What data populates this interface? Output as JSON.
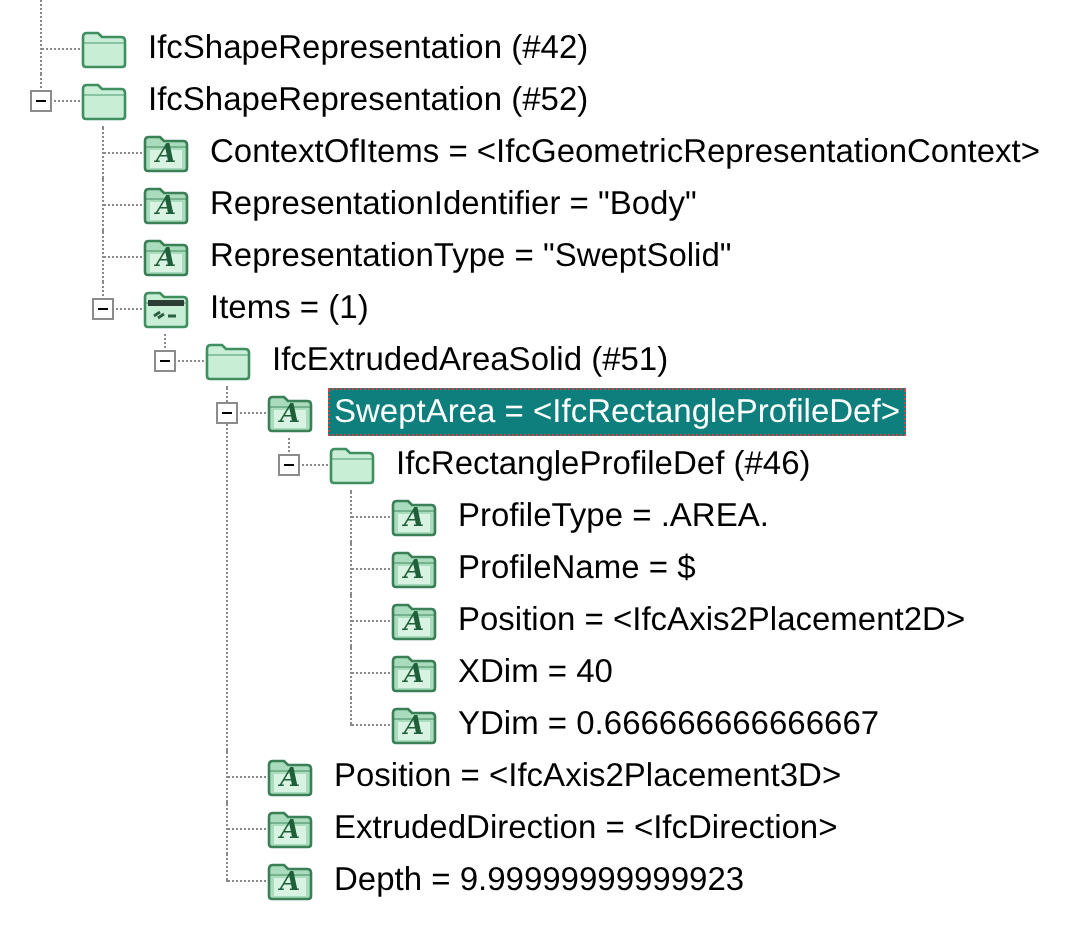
{
  "tree": {
    "nodes": [
      {
        "kind": "entity",
        "label": "IfcShapeRepresentation (#42)",
        "selected": false
      },
      {
        "kind": "entity",
        "label": "IfcShapeRepresentation (#52)",
        "selected": false,
        "expanded": true,
        "children": [
          {
            "kind": "attribute",
            "icon": "A",
            "label": "ContextOfItems = <IfcGeometricRepresentationContext>",
            "selected": false
          },
          {
            "kind": "attribute",
            "icon": "A",
            "label": "RepresentationIdentifier = \"Body\"",
            "selected": false
          },
          {
            "kind": "attribute",
            "icon": "A",
            "label": "RepresentationType = \"SweptSolid\"",
            "selected": false
          },
          {
            "kind": "list",
            "label": "Items = (1)",
            "selected": false,
            "expanded": true,
            "children": [
              {
                "kind": "entity",
                "label": "IfcExtrudedAreaSolid (#51)",
                "selected": false,
                "expanded": true,
                "children": [
                  {
                    "kind": "attribute",
                    "icon": "A",
                    "label": "SweptArea = <IfcRectangleProfileDef>",
                    "selected": true,
                    "expanded": true,
                    "children": [
                      {
                        "kind": "entity",
                        "label": "IfcRectangleProfileDef (#46)",
                        "selected": false,
                        "expanded": true,
                        "children": [
                          {
                            "kind": "attribute",
                            "icon": "A",
                            "label": "ProfileType = .AREA.",
                            "selected": false
                          },
                          {
                            "kind": "attribute",
                            "icon": "A",
                            "label": "ProfileName = $",
                            "selected": false
                          },
                          {
                            "kind": "attribute",
                            "icon": "A",
                            "label": "Position = <IfcAxis2Placement2D>",
                            "selected": false
                          },
                          {
                            "kind": "attribute",
                            "icon": "A",
                            "label": "XDim = 40",
                            "selected": false
                          },
                          {
                            "kind": "attribute",
                            "icon": "A",
                            "label": "YDim = 0.666666666666667",
                            "selected": false
                          }
                        ]
                      }
                    ]
                  },
                  {
                    "kind": "attribute",
                    "icon": "A",
                    "label": "Position = <IfcAxis2Placement3D>",
                    "selected": false
                  },
                  {
                    "kind": "attribute",
                    "icon": "A",
                    "label": "ExtrudedDirection = <IfcDirection>",
                    "selected": false
                  },
                  {
                    "kind": "attribute",
                    "icon": "A",
                    "label": "Depth = 9.99999999999923",
                    "selected": false
                  }
                ]
              }
            ]
          }
        ]
      }
    ]
  }
}
